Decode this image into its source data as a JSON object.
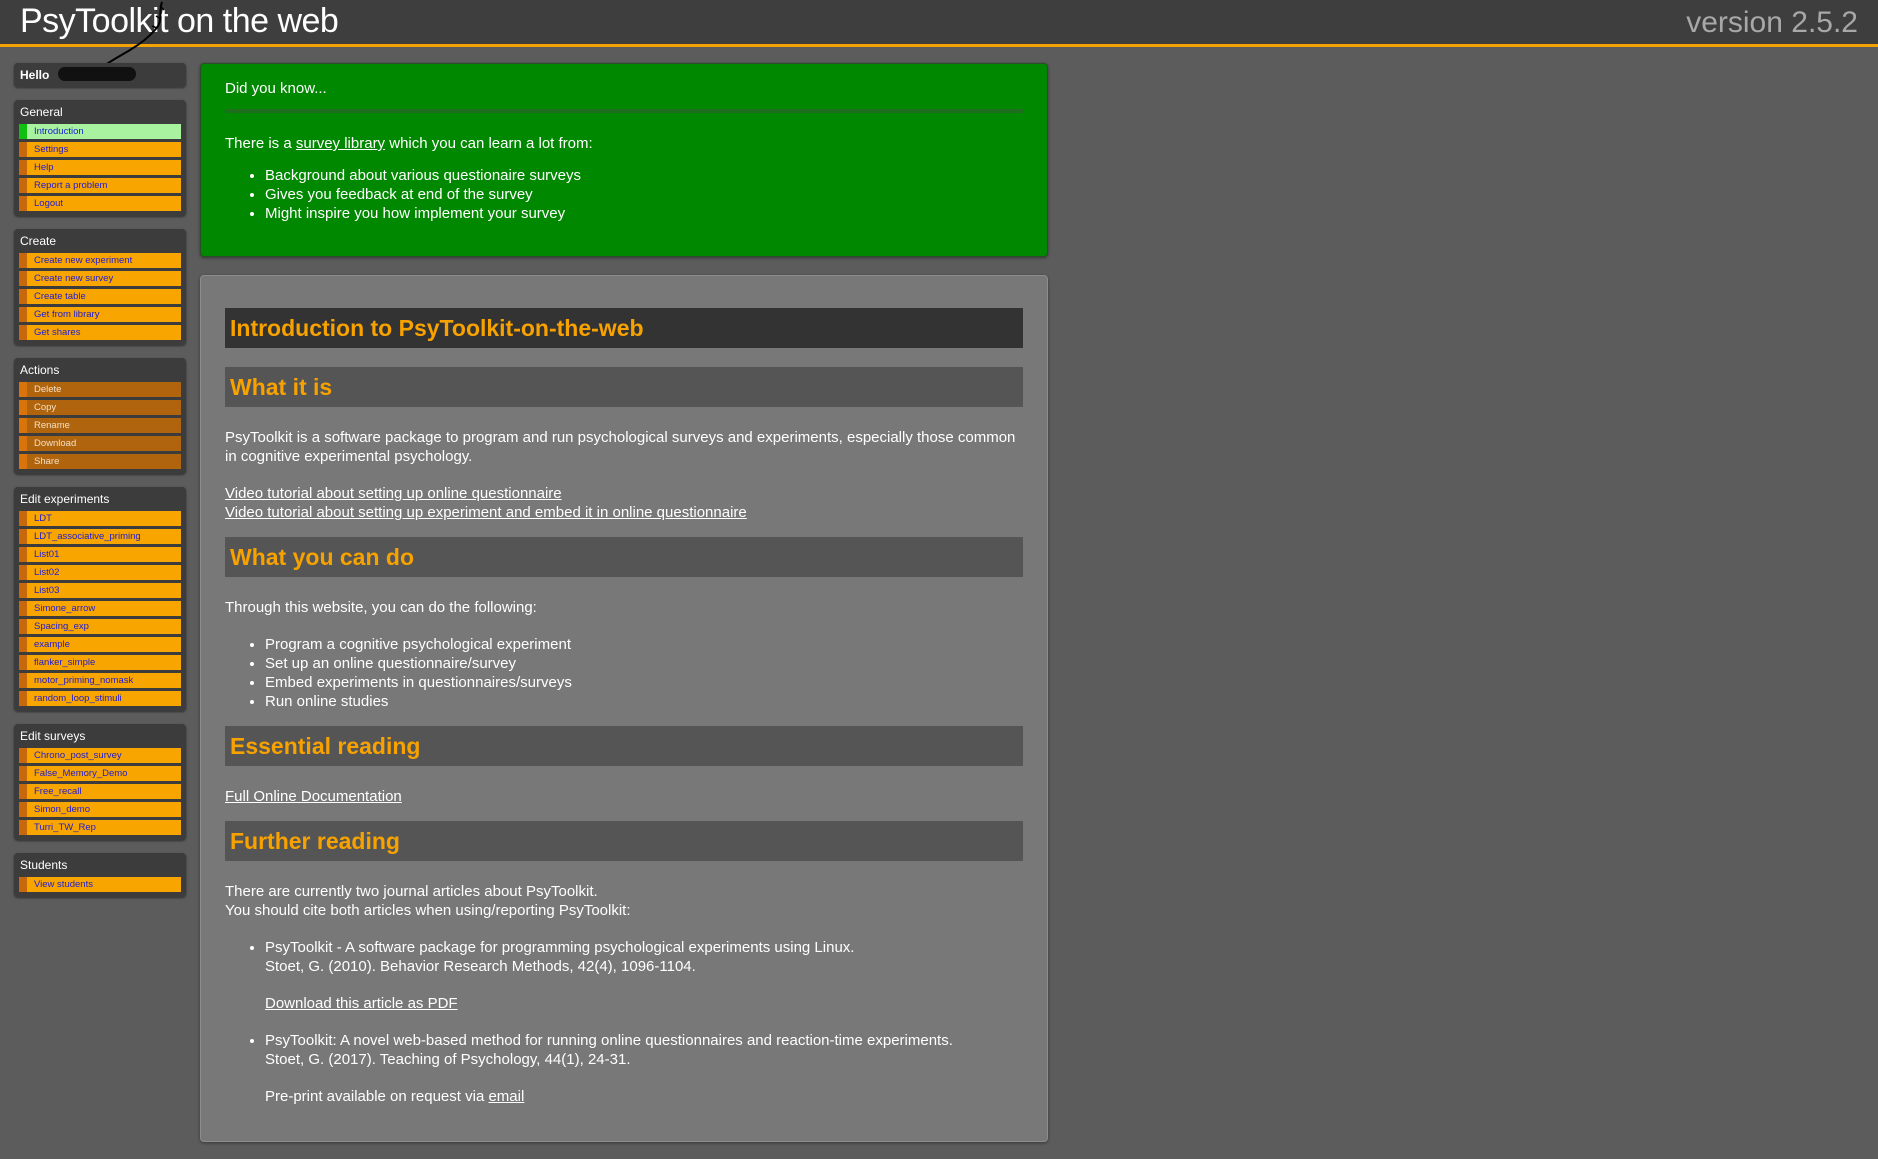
{
  "header": {
    "title": "PsyToolkit on the web",
    "version": "version 2.5.2"
  },
  "sidebar": {
    "hello": "Hello",
    "sections": [
      {
        "title": "General",
        "items": [
          "Introduction",
          "Settings",
          "Help",
          "Report a problem",
          "Logout"
        ]
      },
      {
        "title": "Create",
        "items": [
          "Create new experiment",
          "Create new survey",
          "Create table",
          "Get from library",
          "Get shares"
        ]
      },
      {
        "title": "Actions",
        "items": [
          "Delete",
          "Copy",
          "Rename",
          "Download",
          "Share"
        ]
      },
      {
        "title": "Edit experiments",
        "items": [
          "LDT",
          "LDT_associative_priming",
          "List01",
          "List02",
          "List03",
          "Simone_arrow",
          "Spacing_exp",
          "example",
          "flanker_simple",
          "motor_priming_nomask",
          "random_loop_stimuli"
        ]
      },
      {
        "title": "Edit surveys",
        "items": [
          "Chrono_post_survey",
          "False_Memory_Demo",
          "Free_recall",
          "Simon_demo",
          "Turri_TW_Rep"
        ]
      },
      {
        "title": "Students",
        "items": [
          "View students"
        ]
      }
    ]
  },
  "tip": {
    "title": "Did you know...",
    "text_before": "There is a ",
    "link": "survey library",
    "text_after": " which you can learn a lot from:",
    "bullets": [
      "Background about various questionaire surveys",
      "Gives you feedback at end of the survey",
      "Might inspire you how implement your survey"
    ]
  },
  "main": {
    "title": "Introduction to PsyToolkit-on-the-web",
    "what_heading": "What it is",
    "what_text": "PsyToolkit is a software package to program and run psychological surveys and experiments, especially those common in cognitive experimental psychology.",
    "video1": "Video tutorial about setting up online questionnaire",
    "video2": "Video tutorial about setting up experiment and embed it in online questionnaire",
    "can_heading": "What you can do",
    "can_intro": "Through this website, you can do the following:",
    "can_items": [
      "Program a cognitive psychological experiment",
      "Set up an online questionnaire/survey",
      "Embed experiments in questionnaires/surveys",
      "Run online studies"
    ],
    "essential_heading": "Essential reading",
    "essential_link": "Full Online Documentation",
    "further_heading": "Further reading",
    "further_line1": "There are currently two journal articles about PsyToolkit.",
    "further_line2": "You should cite both articles when using/reporting PsyToolkit:",
    "article1_title": "PsyToolkit - A software package for programming psychological experiments using Linux.",
    "article1_cite": "Stoet, G. (2010). Behavior Research Methods, 42(4), 1096-1104.",
    "article1_link": "Download this article as PDF",
    "article2_title": "PsyToolkit: A novel web-based method for running online questionnaires and reaction-time experiments.",
    "article2_cite": "Stoet, G. (2017). Teaching of Psychology, 44(1), 24-31.",
    "article2_pre": "Pre-print available on request via ",
    "article2_link": "email"
  }
}
